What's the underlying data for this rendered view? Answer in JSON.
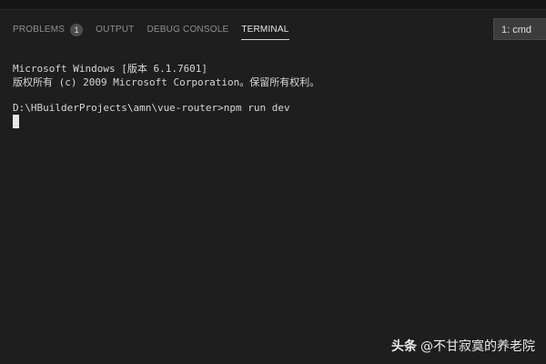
{
  "panel": {
    "tabs": [
      {
        "label": "PROBLEMS",
        "badge": "1"
      },
      {
        "label": "OUTPUT"
      },
      {
        "label": "DEBUG CONSOLE"
      },
      {
        "label": "TERMINAL",
        "active": true
      }
    ],
    "terminal_select": "1: cmd"
  },
  "terminal": {
    "lines": [
      "Microsoft Windows [版本 6.1.7601]",
      "版权所有 (c) 2009 Microsoft Corporation。保留所有权利。",
      "D:\\HBuilderProjects\\amn\\vue-router>npm run dev"
    ]
  },
  "watermark": {
    "brand": "头条",
    "author": "@不甘寂寞的养老院"
  },
  "colors": {
    "background": "#1e1e1e",
    "tab_inactive": "#8f8f8f",
    "tab_active": "#e7e7e7",
    "terminal_text": "#d6d6d6"
  }
}
